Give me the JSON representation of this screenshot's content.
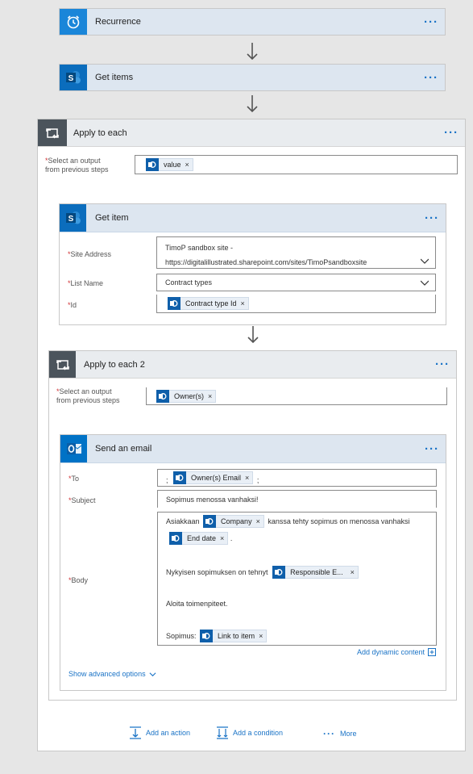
{
  "recurrence": {
    "title": "Recurrence",
    "menu_icon": "ellipsis-icon"
  },
  "get_items": {
    "title": "Get items"
  },
  "apply_each": {
    "title": "Apply to each",
    "select_label_line1": "Select an output",
    "select_label_line2": "from previous steps",
    "token": "value"
  },
  "get_item": {
    "title": "Get item",
    "site_label": "Site Address",
    "site_value_line1": "TimoP sandbox site -",
    "site_value_line2": "https://digitalillustrated.sharepoint.com/sites/TimoPsandboxsite",
    "list_label": "List Name",
    "list_value": "Contract types",
    "id_label": "Id",
    "id_token": "Contract type Id"
  },
  "apply_each2": {
    "title": "Apply to each 2",
    "select_label_line1": "Select an output",
    "select_label_line2": "from previous steps",
    "token": "Owner(s)"
  },
  "send_email": {
    "title": "Send an email",
    "to_label": "To",
    "to_prefix": ";",
    "to_token": "Owner(s) Email",
    "to_suffix": ";",
    "subject_label": "Subject",
    "subject_value": "Sopimus menossa vanhaksi!",
    "body_label": "Body",
    "body": {
      "l1_text1": "Asiakkaan",
      "l1_token1": "Company",
      "l1_text2": "kanssa tehty sopimus on menossa vanhaksi",
      "l2_token": "End date",
      "l2_text": ".",
      "l3_text": "Nykyisen sopimuksen on tehnyt",
      "l3_token": "Responsible E...",
      "l4_text": "Aloita toimenpiteet.",
      "l5_text": "Sopimus:",
      "l5_token": "Link to item"
    },
    "add_dynamic": "Add dynamic content",
    "show_advanced": "Show advanced options"
  },
  "footer": {
    "add_action": "Add an action",
    "add_condition": "Add a condition",
    "more": "More"
  },
  "required_marker": "*",
  "ellipsis": "···",
  "token_remove": "×",
  "colors": {
    "accent": "#1a73c6",
    "header": "#dde6f0",
    "required": "#d13438",
    "sharepoint": "#0b6dbd"
  }
}
